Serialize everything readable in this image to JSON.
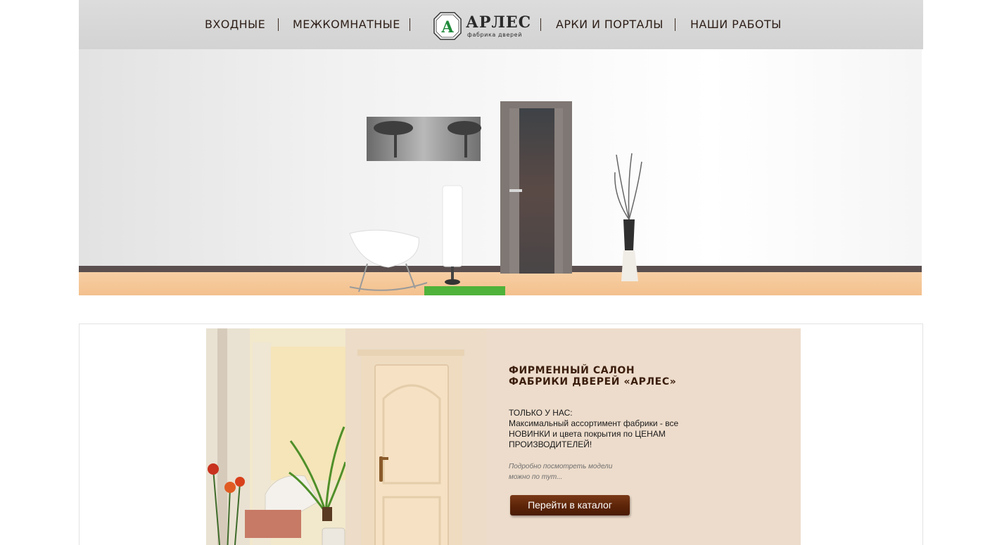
{
  "nav": {
    "left": [
      {
        "label": "ВХОДНЫЕ"
      },
      {
        "label": "МЕЖКОМНАТНЫЕ"
      }
    ],
    "right": [
      {
        "label": "АРКИ И ПОРТАЛЫ"
      },
      {
        "label": "НАШИ РАБОТЫ"
      }
    ]
  },
  "logo": {
    "mark": "A",
    "word": "АРЛЕС",
    "subtitle": "фабрика дверей"
  },
  "promo": {
    "title_line1": "ФИРМЕННЫЙ САЛОН",
    "title_line2": "ФАБРИКИ ДВЕРЕЙ «АРЛЕС»",
    "body": "ТОЛЬКО У НАС:\nМаксимальный ассортимент фабрики - все НОВИНКИ и цвета покрытия по ЦЕНАМ ПРОИЗВОДИТЕЛЕЙ!",
    "note_line1": "Подробно посмотреть модели",
    "note_line2": "можно по тут...",
    "button_label": "Перейти в каталог"
  },
  "colors": {
    "header_bg": "#d6d6d6",
    "nav_text": "#2e1f18",
    "logo_green": "#1f8a3a",
    "promo_bg": "#eddccb",
    "title_brown": "#3b1d0c",
    "button_brown": "#5c2408"
  }
}
